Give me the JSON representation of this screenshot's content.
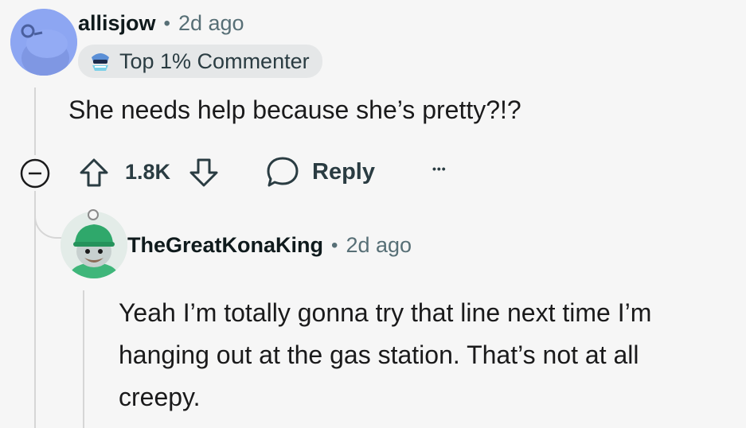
{
  "comment": {
    "username": "allisjow",
    "separator": "•",
    "time": "2d ago",
    "badge": "Top 1% Commenter",
    "text": "She needs help because she’s pretty?!?",
    "votes": "1.8K",
    "reply_label": "Reply",
    "more_label": "•••"
  },
  "reply": {
    "username": "TheGreatKonaKing",
    "separator": "•",
    "time": "2d ago",
    "text_lines": [
      "Yeah I’m totally gonna try that line next time I’m",
      "hanging out at the gas station. That’s not at all",
      "creepy."
    ]
  },
  "colors": {
    "background": "#f6f6f6",
    "thread_line": "#d6d6d6",
    "avatar_blue": "#8da6f2",
    "meta_gray": "#576f76"
  },
  "icons": [
    "snoo-avatar-icon",
    "top-commenter-badge-icon",
    "collapse-icon",
    "upvote-icon",
    "downvote-icon",
    "comment-bubble-icon",
    "overflow-menu-icon"
  ]
}
